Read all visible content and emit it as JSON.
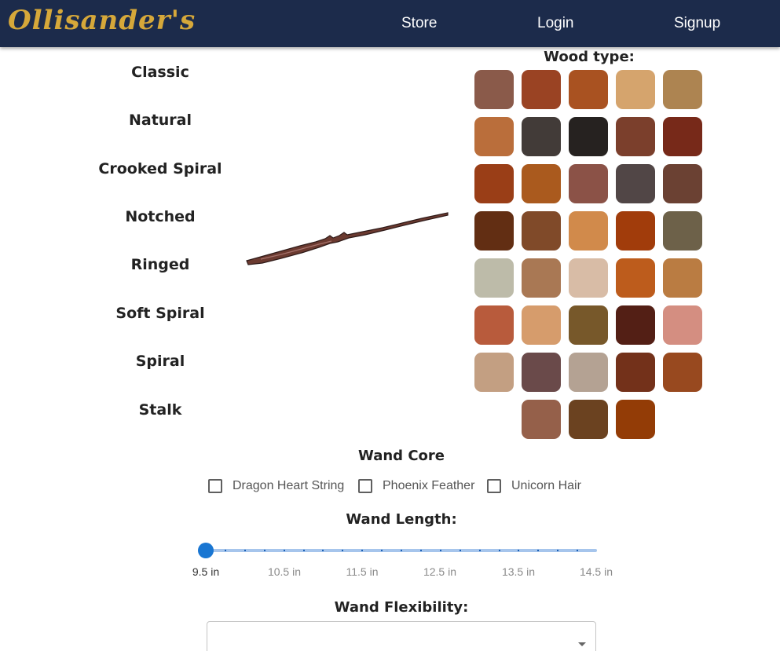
{
  "header": {
    "logo": "Ollisander's",
    "nav": [
      "Store",
      "Login",
      "Signup"
    ]
  },
  "wand_styles": [
    "Classic",
    "Natural",
    "Crooked Spiral",
    "Notched",
    "Ringed",
    "Soft Spiral",
    "Spiral",
    "Stalk"
  ],
  "wood_type": {
    "title": "Wood type:",
    "swatch_rows": [
      [
        "#8a5a4a",
        "#9a4323",
        "#a95221",
        "#d5a46d",
        "#ad8451"
      ],
      [
        "#ba6e3b",
        "#423b38",
        "#262220",
        "#7b3f2c",
        "#772919"
      ],
      [
        "#9a3e17",
        "#aa5a1e",
        "#8b5247",
        "#514646",
        "#6b4133"
      ],
      [
        "#622e13",
        "#804a29",
        "#d18a4b",
        "#a13c0b",
        "#6d6149"
      ],
      [
        "#bdbba9",
        "#a97854",
        "#d8bca6",
        "#bd5c1c",
        "#ba7c42"
      ],
      [
        "#b85b3c",
        "#d69c6c",
        "#77582a",
        "#531f15",
        "#d48e81"
      ],
      [
        "#c39f82",
        "#6a4a4a",
        "#b4a293",
        "#73311a",
        "#98491f"
      ],
      [
        null,
        "#95604a",
        "#6b4220",
        "#933c06",
        null
      ]
    ]
  },
  "wand_core": {
    "title": "Wand Core",
    "options": [
      "Dragon Heart String",
      "Phoenix Feather",
      "Unicorn Hair"
    ]
  },
  "wand_length": {
    "title": "Wand Length:",
    "value": 9.5,
    "min": 9.5,
    "max": 14.5,
    "step": 0.25,
    "marks": [
      "9.5 in",
      "10.5 in",
      "11.5 in",
      "12.5 in",
      "13.5 in",
      "14.5 in"
    ]
  },
  "wand_flexibility": {
    "title": "Wand Flexibility:",
    "value": ""
  }
}
